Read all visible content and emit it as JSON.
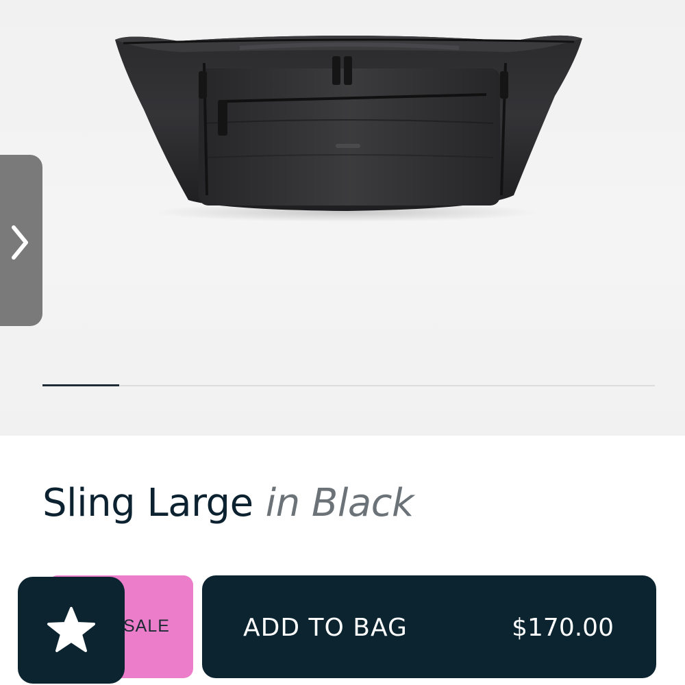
{
  "gallery": {
    "current_slide": 1,
    "total_slides": 8,
    "next_icon": "chevron-right-icon"
  },
  "product": {
    "name": "Sling Large",
    "color": "in Black"
  },
  "actions": {
    "wishlist_icon": "star-icon",
    "sale_label": "SALE",
    "add_to_bag_label": "ADD TO BAG",
    "price": "$170.00"
  },
  "colors": {
    "accent_dark": "#0b2430",
    "sale_pink": "#ec7dca"
  }
}
